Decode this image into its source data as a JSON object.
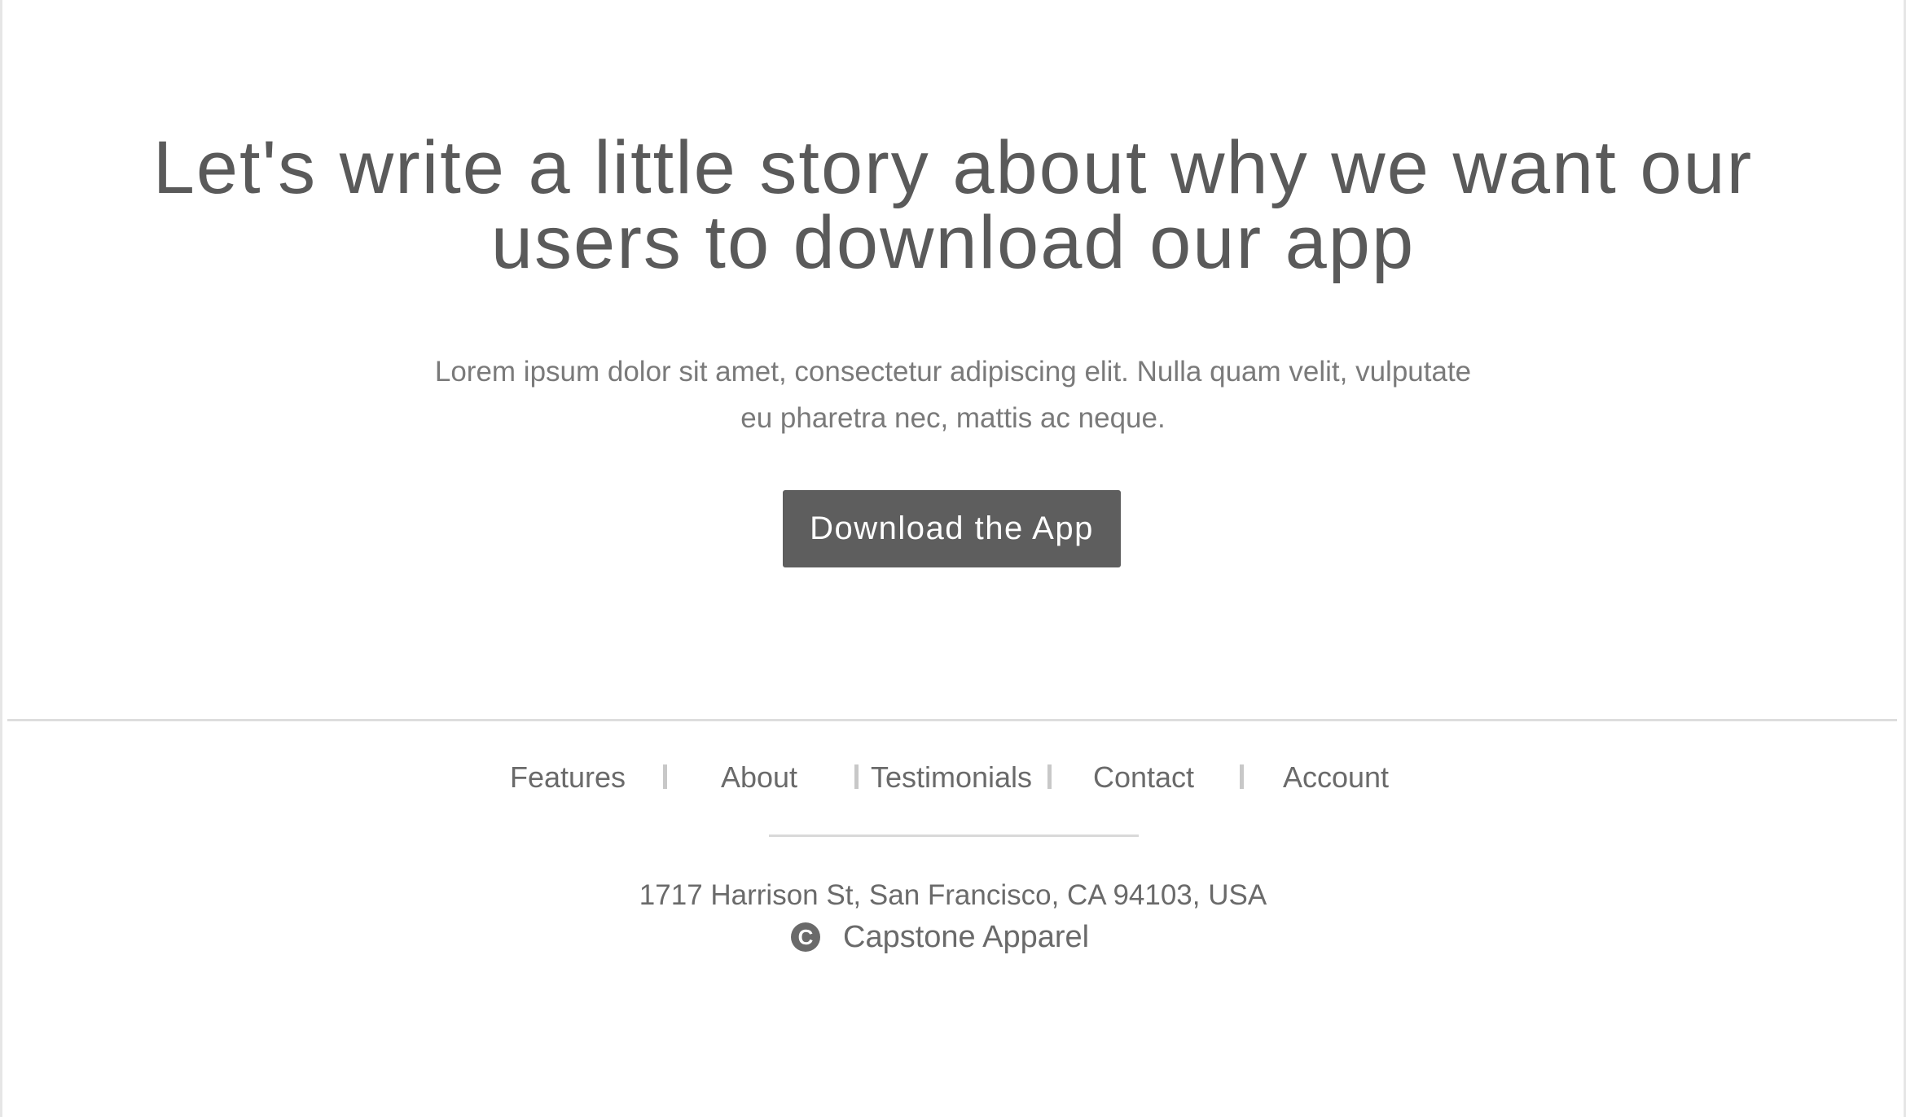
{
  "hero": {
    "headline": "Let's write a little story about why we want our users to download our app",
    "subtext": "Lorem ipsum dolor sit amet, consectetur adipiscing elit. Nulla quam velit, vulputate eu pharetra nec, mattis ac neque.",
    "cta_label": "Download the App"
  },
  "footer": {
    "nav": [
      {
        "label": "Features"
      },
      {
        "label": "About"
      },
      {
        "label": "Testimonials"
      },
      {
        "label": "Contact"
      },
      {
        "label": "Account"
      }
    ],
    "address": "1717 Harrison St, San Francisco, CA 94103, USA",
    "copyright_icon": "copyright-icon",
    "copyright_glyph": "C",
    "company": "Capstone Apparel"
  },
  "colors": {
    "button_bg": "#5e5e5e",
    "text_dark": "#5a5a5a",
    "text_muted": "#7a7a7a",
    "divider": "#dddddd"
  }
}
